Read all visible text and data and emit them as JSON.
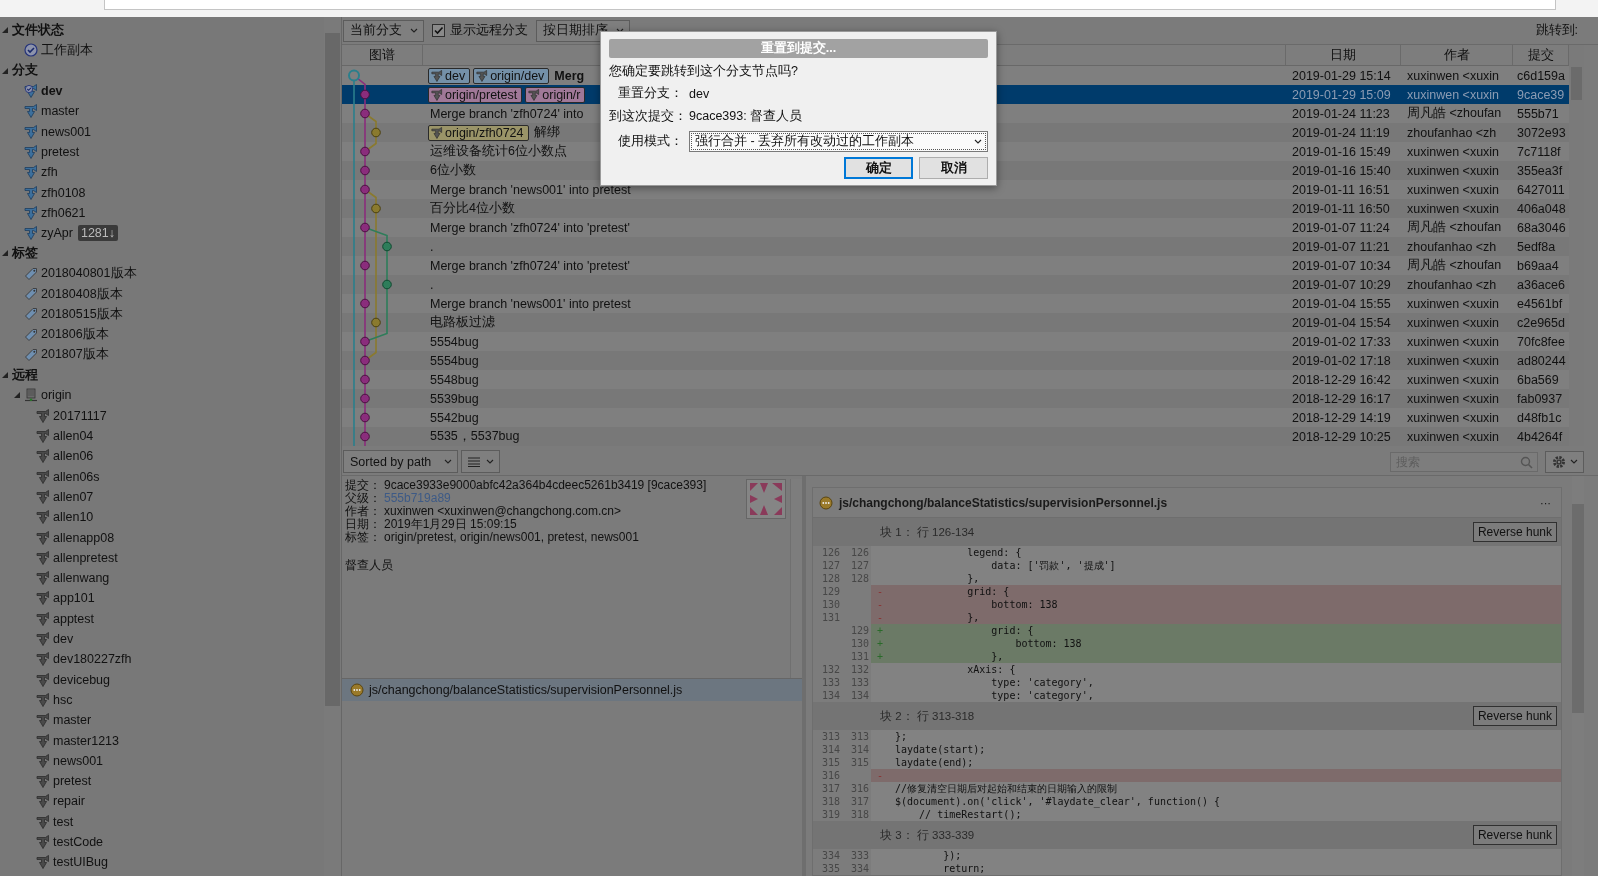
{
  "sidebar": {
    "sections": [
      {
        "label": "文件状态",
        "expanded": true,
        "items": [
          {
            "kind": "working-copy",
            "label": "工作副本"
          }
        ]
      },
      {
        "label": "分支",
        "expanded": true,
        "items": [
          {
            "kind": "branch",
            "label": "dev",
            "current": true
          },
          {
            "kind": "branch",
            "label": "master",
            "current": false
          },
          {
            "kind": "branch",
            "label": "news001",
            "current": false
          },
          {
            "kind": "branch",
            "label": "pretest",
            "current": false
          },
          {
            "kind": "branch",
            "label": "zfh",
            "current": false
          },
          {
            "kind": "branch",
            "label": "zfh0108",
            "current": false
          },
          {
            "kind": "branch",
            "label": "zfh0621",
            "current": false
          },
          {
            "kind": "branch",
            "label": "zyApr",
            "current": false,
            "badge": "1281↓"
          }
        ]
      },
      {
        "label": "标签",
        "expanded": true,
        "items": [
          {
            "kind": "tag",
            "label": "2018040801版本"
          },
          {
            "kind": "tag",
            "label": "20180408版本"
          },
          {
            "kind": "tag",
            "label": "20180515版本"
          },
          {
            "kind": "tag",
            "label": "201806版本"
          },
          {
            "kind": "tag",
            "label": "201807版本"
          }
        ]
      },
      {
        "label": "远程",
        "expanded": true,
        "items": [
          {
            "kind": "remote",
            "label": "origin",
            "expanded": true,
            "children": [
              {
                "kind": "remote-branch",
                "label": "20171117"
              },
              {
                "kind": "remote-branch",
                "label": "allen04"
              },
              {
                "kind": "remote-branch",
                "label": "allen06"
              },
              {
                "kind": "remote-branch",
                "label": "allen06s"
              },
              {
                "kind": "remote-branch",
                "label": "allen07"
              },
              {
                "kind": "remote-branch",
                "label": "allen10"
              },
              {
                "kind": "remote-branch",
                "label": "allenapp08"
              },
              {
                "kind": "remote-branch",
                "label": "allenpretest"
              },
              {
                "kind": "remote-branch",
                "label": "allenwang"
              },
              {
                "kind": "remote-branch",
                "label": "app101"
              },
              {
                "kind": "remote-branch",
                "label": "apptest"
              },
              {
                "kind": "remote-branch",
                "label": "dev"
              },
              {
                "kind": "remote-branch",
                "label": "dev180227zfh"
              },
              {
                "kind": "remote-branch",
                "label": "devicebug"
              },
              {
                "kind": "remote-branch",
                "label": "hsc"
              },
              {
                "kind": "remote-branch",
                "label": "master"
              },
              {
                "kind": "remote-branch",
                "label": "master1213"
              },
              {
                "kind": "remote-branch",
                "label": "news001"
              },
              {
                "kind": "remote-branch",
                "label": "pretest"
              },
              {
                "kind": "remote-branch",
                "label": "repair"
              },
              {
                "kind": "remote-branch",
                "label": "test"
              },
              {
                "kind": "remote-branch",
                "label": "testCode"
              },
              {
                "kind": "remote-branch",
                "label": "testUIBug"
              }
            ]
          }
        ]
      }
    ]
  },
  "toolbar": {
    "branch_filter": "当前分支",
    "show_remote": {
      "label": "显示远程分支",
      "checked": true
    },
    "sort": "按日期排序",
    "jump_label": "跳转到:"
  },
  "table": {
    "columns": {
      "graph": "图谱",
      "date": "日期",
      "author": "作者",
      "commit": "提交"
    },
    "rows": [
      {
        "refs": [
          {
            "label": "dev",
            "color": "#7490a8"
          },
          {
            "label": "origin/dev",
            "color": "#7490a8"
          }
        ],
        "description": "Merg",
        "current": true,
        "selected": false,
        "date": "2019-01-29 15:14",
        "author": "xuxinwen <xuxin",
        "commit": "c6d159a"
      },
      {
        "refs": [
          {
            "label": "origin/pretest",
            "color": "#a07898"
          },
          {
            "label": "origin/r",
            "color": "#a07898"
          }
        ],
        "selected": true,
        "date": "2019-01-29 15:09",
        "author": "xuxinwen <xuxin",
        "commit": "9cace39"
      },
      {
        "description": "Merge branch 'zfh0724' into",
        "current": false,
        "selected": false,
        "date": "2019-01-24 11:23",
        "author": "周凡皓 <zhoufan",
        "commit": "555b71"
      },
      {
        "refs": [
          {
            "label": "origin/zfh0724",
            "color": "#9a9468"
          }
        ],
        "description": "解绑",
        "current": false,
        "selected": false,
        "date": "2019-01-24 11:19",
        "author": "zhoufanhao <zh",
        "commit": "3072e93"
      },
      {
        "description": "运维设备统计6位小数点",
        "current": false,
        "selected": false,
        "date": "2019-01-16 15:49",
        "author": "xuxinwen <xuxin",
        "commit": "7c7118f"
      },
      {
        "description": "6位小数",
        "current": false,
        "selected": false,
        "date": "2019-01-16 15:40",
        "author": "xuxinwen <xuxin",
        "commit": "355ea3f"
      },
      {
        "description": "Merge branch 'news001' into pretest",
        "current": false,
        "selected": false,
        "date": "2019-01-11 16:51",
        "author": "xuxinwen <xuxin",
        "commit": "6427011"
      },
      {
        "description": "百分比4位小数",
        "current": false,
        "selected": false,
        "date": "2019-01-11 16:50",
        "author": "xuxinwen <xuxin",
        "commit": "406a048"
      },
      {
        "description": "Merge branch 'zfh0724' into 'pretest'",
        "current": false,
        "selected": false,
        "date": "2019-01-07 11:24",
        "author": "周凡皓 <zhoufan",
        "commit": "68a3046"
      },
      {
        "description": ".",
        "current": false,
        "selected": false,
        "date": "2019-01-07 11:21",
        "author": "zhoufanhao <zh",
        "commit": "5edf8a"
      },
      {
        "description": "Merge branch 'zfh0724' into 'pretest'",
        "current": false,
        "selected": false,
        "date": "2019-01-07 10:34",
        "author": "周凡皓 <zhoufan",
        "commit": "b69aa4"
      },
      {
        "description": ".",
        "current": false,
        "selected": false,
        "date": "2019-01-07 10:29",
        "author": "zhoufanhao <zh",
        "commit": "a36ace6"
      },
      {
        "description": "Merge branch 'news001' into pretest",
        "current": false,
        "selected": false,
        "date": "2019-01-04 15:55",
        "author": "xuxinwen <xuxin",
        "commit": "e4561bf"
      },
      {
        "description": "电路板过滤",
        "current": false,
        "selected": false,
        "date": "2019-01-04 15:54",
        "author": "xuxinwen <xuxin",
        "commit": "c2e965d"
      },
      {
        "description": "5554bug",
        "current": false,
        "selected": false,
        "date": "2019-01-02 17:33",
        "author": "xuxinwen <xuxin",
        "commit": "70fc8fee"
      },
      {
        "description": "5554bug",
        "current": false,
        "selected": false,
        "date": "2019-01-02 17:18",
        "author": "xuxinwen <xuxin",
        "commit": "ad80244"
      },
      {
        "description": "5548bug",
        "current": false,
        "selected": false,
        "date": "2018-12-29 16:42",
        "author": "xuxinwen <xuxin",
        "commit": "6ba569"
      },
      {
        "description": "5539bug",
        "current": false,
        "selected": false,
        "date": "2018-12-29 16:17",
        "author": "xuxinwen <xuxin",
        "commit": "fab0937"
      },
      {
        "description": "5542bug",
        "current": false,
        "selected": false,
        "date": "2018-12-29 14:19",
        "author": "xuxinwen <xuxin",
        "commit": "d48fb1c"
      },
      {
        "description": "5535，5537bug",
        "current": false,
        "selected": false,
        "date": "2018-12-29 10:25",
        "author": "xuxinwen <xuxin",
        "commit": "4b4264f"
      }
    ]
  },
  "lower_toolbar": {
    "sort": "Sorted by path",
    "search": {
      "placeholder": "搜索"
    }
  },
  "commit_details": {
    "fields": [
      {
        "label": "提交：",
        "value": "9cace3933e9000abfc42a364b4cdeec5261b3419 [9cace393]",
        "kind": "text"
      },
      {
        "label": "父级：",
        "value": "555b719a89",
        "kind": "link"
      },
      {
        "label": "作者：",
        "value": "xuxinwen <xuxinwen@changchong.com.cn>",
        "kind": "text"
      },
      {
        "label": "日期：",
        "value": "2019年1月29日 15:09:15",
        "kind": "text"
      },
      {
        "label": "标签：",
        "value": "origin/pretest, origin/news001, pretest, news001",
        "kind": "text"
      }
    ],
    "message": "督查人员"
  },
  "files": [
    {
      "path": "js/changchong/balanceStatistics/supervisionPersonnel.js",
      "selected": true
    }
  ],
  "diff": {
    "file": {
      "path": "js/changchong/balanceStatistics/supervisionPersonnel.js",
      "menu": "···"
    },
    "hunks": [
      {
        "title": "块 1： 行 126-134",
        "button": "Reverse hunk",
        "lines": [
          {
            "old": "126",
            "new": "126",
            "kind": "context",
            "code": "            legend: {"
          },
          {
            "old": "127",
            "new": "127",
            "kind": "context",
            "code": "                data: ['罚款', '提成']"
          },
          {
            "old": "128",
            "new": "128",
            "kind": "context",
            "code": "            },"
          },
          {
            "old": "129",
            "kind": "removed",
            "marker": "-",
            "code": "            grid: {"
          },
          {
            "old": "130",
            "kind": "removed",
            "marker": "-",
            "code": "                bottom: 138"
          },
          {
            "old": "131",
            "kind": "removed",
            "marker": "-",
            "code": "            },"
          },
          {
            "new": "129",
            "kind": "added",
            "marker": "+",
            "code": "                grid: {"
          },
          {
            "new": "130",
            "kind": "added",
            "marker": "+",
            "code": "                    bottom: 138"
          },
          {
            "new": "131",
            "kind": "added",
            "marker": "+",
            "code": "                },"
          },
          {
            "old": "132",
            "new": "132",
            "kind": "context",
            "code": "            xAxis: {"
          },
          {
            "old": "133",
            "new": "133",
            "kind": "context",
            "code": "                type: 'category',"
          },
          {
            "old": "134",
            "new": "134",
            "kind": "context",
            "code": "                type: 'category',"
          }
        ]
      },
      {
        "title": "块 2： 行 313-318",
        "button": "Reverse hunk",
        "lines": [
          {
            "old": "313",
            "new": "313",
            "kind": "context",
            "code": "};"
          },
          {
            "old": "314",
            "new": "314",
            "kind": "context",
            "code": "laydate(start);"
          },
          {
            "old": "315",
            "new": "315",
            "kind": "context",
            "code": "laydate(end);"
          },
          {
            "old": "316",
            "kind": "removed",
            "marker": "-"
          },
          {
            "old": "317",
            "new": "316",
            "kind": "context",
            "code": "//修复清空日期后对起始和结束的日期输入的限制"
          },
          {
            "old": "318",
            "new": "317",
            "kind": "context",
            "code": "$(document).on('click', '#laydate_clear', function() {"
          },
          {
            "old": "319",
            "new": "318",
            "kind": "context",
            "code": "    // timeRestart();"
          }
        ]
      },
      {
        "title": "块 3： 行 333-339",
        "button": "Reverse hunk",
        "lines": [
          {
            "old": "334",
            "new": "333",
            "kind": "context",
            "code": "        });"
          },
          {
            "old": "335",
            "new": "334",
            "kind": "context",
            "code": "        return;"
          }
        ]
      }
    ]
  },
  "dialog": {
    "title": "重置到提交...",
    "question": "您确定要跳转到这个分支节点吗?",
    "fields": [
      {
        "label": "重置分支：",
        "value": "dev"
      },
      {
        "label": "到这次提交：",
        "value": "9cace393: 督查人员"
      }
    ],
    "mode": {
      "label": "使用模式：",
      "value": "强行合并 - 丢弃所有改动过的工作副本"
    },
    "buttons": [
      {
        "label": "确定",
        "default": true
      },
      {
        "label": "取消",
        "default": false
      }
    ]
  }
}
